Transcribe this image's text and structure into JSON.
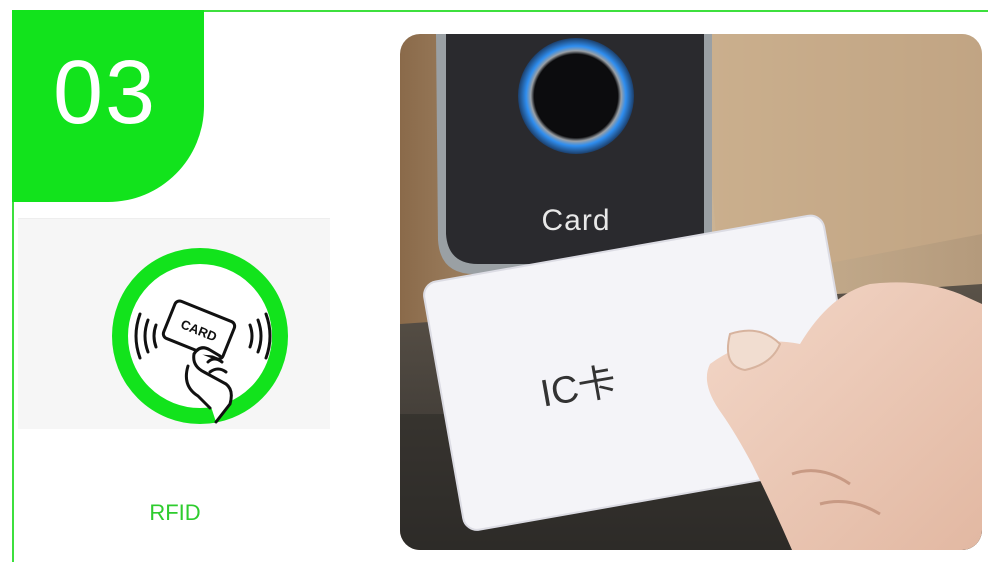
{
  "step": {
    "number": "03"
  },
  "feature": {
    "label": "RFID",
    "icon": "rfid-card-tap-icon",
    "icon_text": "CARD"
  },
  "photo": {
    "reader_label": "Card",
    "card_label": "IC卡",
    "subject": "fingerprint-card-reader-photo"
  },
  "colors": {
    "accent": "#12e31c",
    "frame": "#3de03d",
    "label": "#2ecc2e",
    "reader_panel": "#2a2a2e",
    "fingerprint_ring": "#2f8ef0"
  }
}
